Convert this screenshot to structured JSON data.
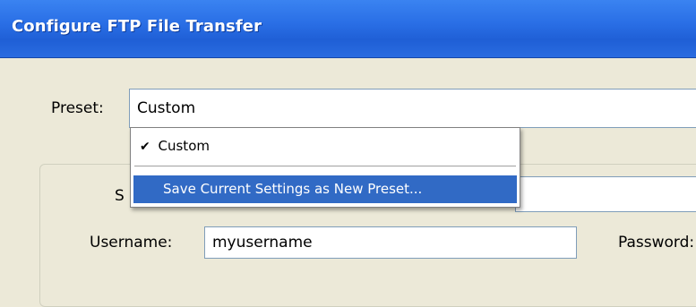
{
  "window": {
    "title": "Configure FTP File Transfer"
  },
  "preset": {
    "label": "Preset:",
    "value": "Custom",
    "menu": {
      "items": [
        {
          "label": "Custom",
          "checked": true,
          "check_mark": "✔"
        },
        {
          "label": "Save Current Settings as New Preset...",
          "highlighted": true
        }
      ]
    }
  },
  "server": {
    "label_visible": "S"
  },
  "username": {
    "label": "Username:",
    "value": "myusername"
  },
  "password": {
    "label": "Password:"
  }
}
